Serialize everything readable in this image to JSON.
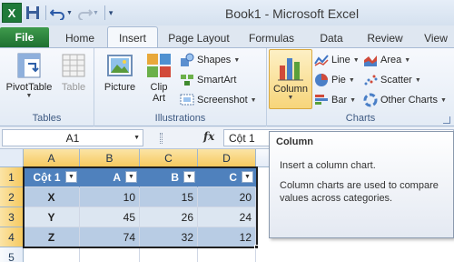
{
  "window": {
    "title": "Book1 - Microsoft Excel",
    "app_icon": "X"
  },
  "quick_access": {
    "save": "save-icon",
    "undo": "undo-icon",
    "redo": "redo-icon",
    "customize": "customize-icon"
  },
  "tabs": {
    "file": "File",
    "items": [
      "Home",
      "Insert",
      "Page Layout",
      "Formulas",
      "Data",
      "Review",
      "View"
    ],
    "active": "Insert"
  },
  "ribbon": {
    "tables": {
      "label": "Tables",
      "pivot": "PivotTable",
      "table": "Table"
    },
    "illustrations": {
      "label": "Illustrations",
      "picture": "Picture",
      "clipart_1": "Clip",
      "clipart_2": "Art",
      "shapes": "Shapes",
      "smartart": "SmartArt",
      "screenshot": "Screenshot"
    },
    "charts": {
      "label": "Charts",
      "column": "Column",
      "line": "Line",
      "pie": "Pie",
      "bar": "Bar",
      "area": "Area",
      "scatter": "Scatter",
      "other": "Other Charts"
    }
  },
  "formula_bar": {
    "name_box": "A1",
    "fx": "fx",
    "value": "Cột 1"
  },
  "grid": {
    "columns": [
      "A",
      "B",
      "C",
      "D"
    ],
    "rows": [
      "1",
      "2",
      "3",
      "4",
      "5"
    ],
    "header_row": [
      "Cột 1",
      "A",
      "B",
      "C"
    ],
    "data": [
      [
        "X",
        "10",
        "15",
        "20"
      ],
      [
        "Y",
        "45",
        "26",
        "24"
      ],
      [
        "Z",
        "74",
        "32",
        "12"
      ]
    ]
  },
  "tooltip": {
    "title": "Column",
    "line1": "Insert a column chart.",
    "line2": "Column charts are used to compare values across categories."
  },
  "colors": {
    "file_tab": "#2a8a3e",
    "table_header": "#4f81bd",
    "band_dark": "#b8cce4",
    "band_light": "#dce6f1",
    "selected_header": "#f6c95f"
  }
}
